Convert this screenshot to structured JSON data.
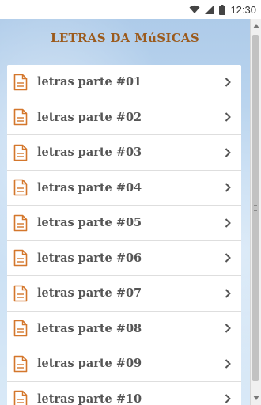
{
  "status_bar": {
    "time": "12:30",
    "icons": [
      "wifi-icon",
      "signal-icon",
      "battery-icon"
    ]
  },
  "title": "LETRAS DA MúSICAS",
  "items": [
    {
      "label": "letras parte #01"
    },
    {
      "label": "letras parte #02"
    },
    {
      "label": "letras parte #03"
    },
    {
      "label": "letras parte #04"
    },
    {
      "label": "letras parte #05"
    },
    {
      "label": "letras parte #06"
    },
    {
      "label": "letras parte #07"
    },
    {
      "label": "letras parte #08"
    },
    {
      "label": "letras parte #09"
    },
    {
      "label": "letras parte #10"
    }
  ],
  "colors": {
    "title": "#9b5a1c",
    "icon": "#d4772c",
    "item_text": "#555555",
    "background": "#c3dbf2"
  }
}
